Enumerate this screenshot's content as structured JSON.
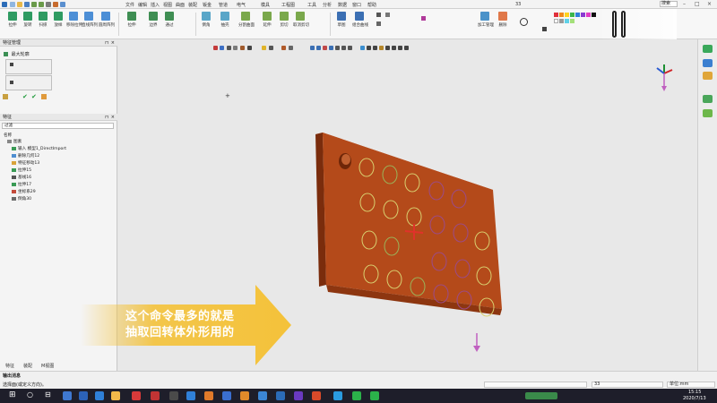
{
  "app": {
    "title_number": "33",
    "search_placeholder": "搜索"
  },
  "menu": {
    "items": [
      "文件",
      "编辑",
      "插入",
      "视图",
      "曲面",
      "装配",
      "钣金",
      "管道",
      "电气",
      "模具",
      "工程图",
      "工具",
      "分析",
      "数据",
      "窗口",
      "帮助"
    ]
  },
  "ribbon": {
    "buttons": [
      {
        "label": "拉伸",
        "icon": "extrude-icon"
      },
      {
        "label": "旋转",
        "icon": "revolve-icon"
      },
      {
        "label": "扫掠",
        "icon": "sweep-icon"
      },
      {
        "label": "放样",
        "icon": "loft-icon"
      },
      {
        "label": "移除拉伸",
        "icon": "cut-extrude-icon"
      },
      {
        "label": "直线阵列",
        "icon": "linear-pattern-icon"
      },
      {
        "label": "圆周阵列",
        "icon": "circular-pattern-icon"
      },
      {
        "label": "拉伸",
        "icon": "extrude-icon"
      },
      {
        "label": "边界",
        "icon": "boundary-icon"
      },
      {
        "label": "通过",
        "icon": "through-icon"
      },
      {
        "label": "倒角",
        "icon": "chamfer-icon"
      },
      {
        "label": "抽壳",
        "icon": "shell-icon"
      },
      {
        "label": "分割曲面",
        "icon": "split-icon"
      },
      {
        "label": "延伸",
        "icon": "extend-icon"
      },
      {
        "label": "剪切",
        "icon": "trim-icon"
      },
      {
        "label": "取消剪切",
        "icon": "untrim-icon"
      },
      {
        "label": "草图",
        "icon": "sketch-icon"
      },
      {
        "label": "组合曲线",
        "icon": "composite-curve-icon"
      },
      {
        "label": "加工管理",
        "icon": "manage-icon"
      },
      {
        "label": "删除",
        "icon": "delete-icon"
      }
    ]
  },
  "colors": {
    "accent": "#2b6cb8",
    "part": "#b44a1a",
    "part_dark": "#7a2c0c",
    "subtitle_yellow": "#f4c23a",
    "subtitle_text": "#ffffff",
    "viewport_bg": "#e8e8e8"
  },
  "left_panel": {
    "feature_manager_title": "特征管理",
    "feature_manager_item": "最大轮廓",
    "feature_tree_title": "特征",
    "filter_placeholder": "过滤",
    "name_header": "名称",
    "tree": [
      {
        "label": "图素",
        "icon": "group-icon"
      },
      {
        "label": "输入 模型1_DirectImport",
        "icon": "import-icon"
      },
      {
        "label": "删除几何12",
        "icon": "delete-geometry-icon"
      },
      {
        "label": "特征移动13",
        "icon": "move-icon"
      },
      {
        "label": "拉伸15",
        "icon": "extrude-icon"
      },
      {
        "label": "基线16",
        "icon": "line-icon"
      },
      {
        "label": "拉伸17",
        "icon": "extrude-icon"
      },
      {
        "label": "坐标系29",
        "icon": "coordinate-icon"
      },
      {
        "label": "倒角30",
        "icon": "chamfer-icon"
      }
    ],
    "bottom_tabs": [
      "特征",
      "装配",
      "M视图"
    ]
  },
  "status": {
    "prompt_title": "输出消息",
    "prompt_text": "选择面(或定义方向)。",
    "center_value": "33",
    "units": "单位:mm"
  },
  "taskbar": {
    "time": "15:15",
    "date": "2020/7/13"
  },
  "subtitle": {
    "line1": "这个命令最多的就是",
    "line2": "抽取回转体外形用的"
  }
}
